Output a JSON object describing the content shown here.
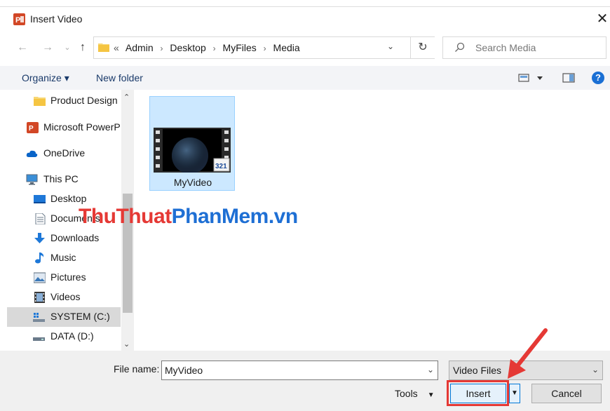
{
  "window": {
    "title": "Insert Video",
    "close_glyph": "✕",
    "app_icon": "powerpoint-icon"
  },
  "nav": {
    "back_glyph": "←",
    "forward_glyph": "→",
    "recent_glyph": "⌄",
    "up_glyph": "↑"
  },
  "address": {
    "overflow": "«",
    "crumbs": [
      "Admin",
      "Desktop",
      "MyFiles",
      "Media"
    ],
    "separator": "›",
    "dropdown_glyph": "⌄",
    "refresh_glyph": "↻"
  },
  "search": {
    "placeholder": "Search Media",
    "icon": "search-icon"
  },
  "toolbar": {
    "organize_label": "Organize ▾",
    "new_folder_label": "New folder",
    "help_label": "?"
  },
  "sidebar": {
    "items": [
      {
        "label": "Product Design",
        "icon": "folder-icon"
      },
      {
        "label": "Microsoft PowerP",
        "icon": "powerpoint-icon"
      },
      {
        "label": "OneDrive",
        "icon": "cloud-icon"
      },
      {
        "label": "This PC",
        "icon": "computer-icon"
      },
      {
        "label": "Desktop",
        "icon": "desktop-icon"
      },
      {
        "label": "Documents",
        "icon": "document-icon"
      },
      {
        "label": "Downloads",
        "icon": "download-icon"
      },
      {
        "label": "Music",
        "icon": "music-icon"
      },
      {
        "label": "Pictures",
        "icon": "pictures-icon"
      },
      {
        "label": "Videos",
        "icon": "videos-icon"
      },
      {
        "label": "SYSTEM (C:)",
        "icon": "drive-icon",
        "selected": true
      },
      {
        "label": "DATA (D:)",
        "icon": "drive-icon"
      }
    ]
  },
  "files": [
    {
      "name": "MyVideo",
      "icon": "video-file-icon",
      "badge": "321"
    }
  ],
  "watermark": {
    "part1": "ThuThuat",
    "part2": "PhanMem.vn"
  },
  "footer": {
    "file_name_label": "File name:",
    "file_name_value": "MyVideo",
    "file_type_value": "Video Files",
    "tools_label": "Tools",
    "insert_label": "Insert",
    "cancel_label": "Cancel"
  },
  "colors": {
    "accent": "#0078d7",
    "selection": "#cce8ff",
    "highlight": "#e53935"
  }
}
